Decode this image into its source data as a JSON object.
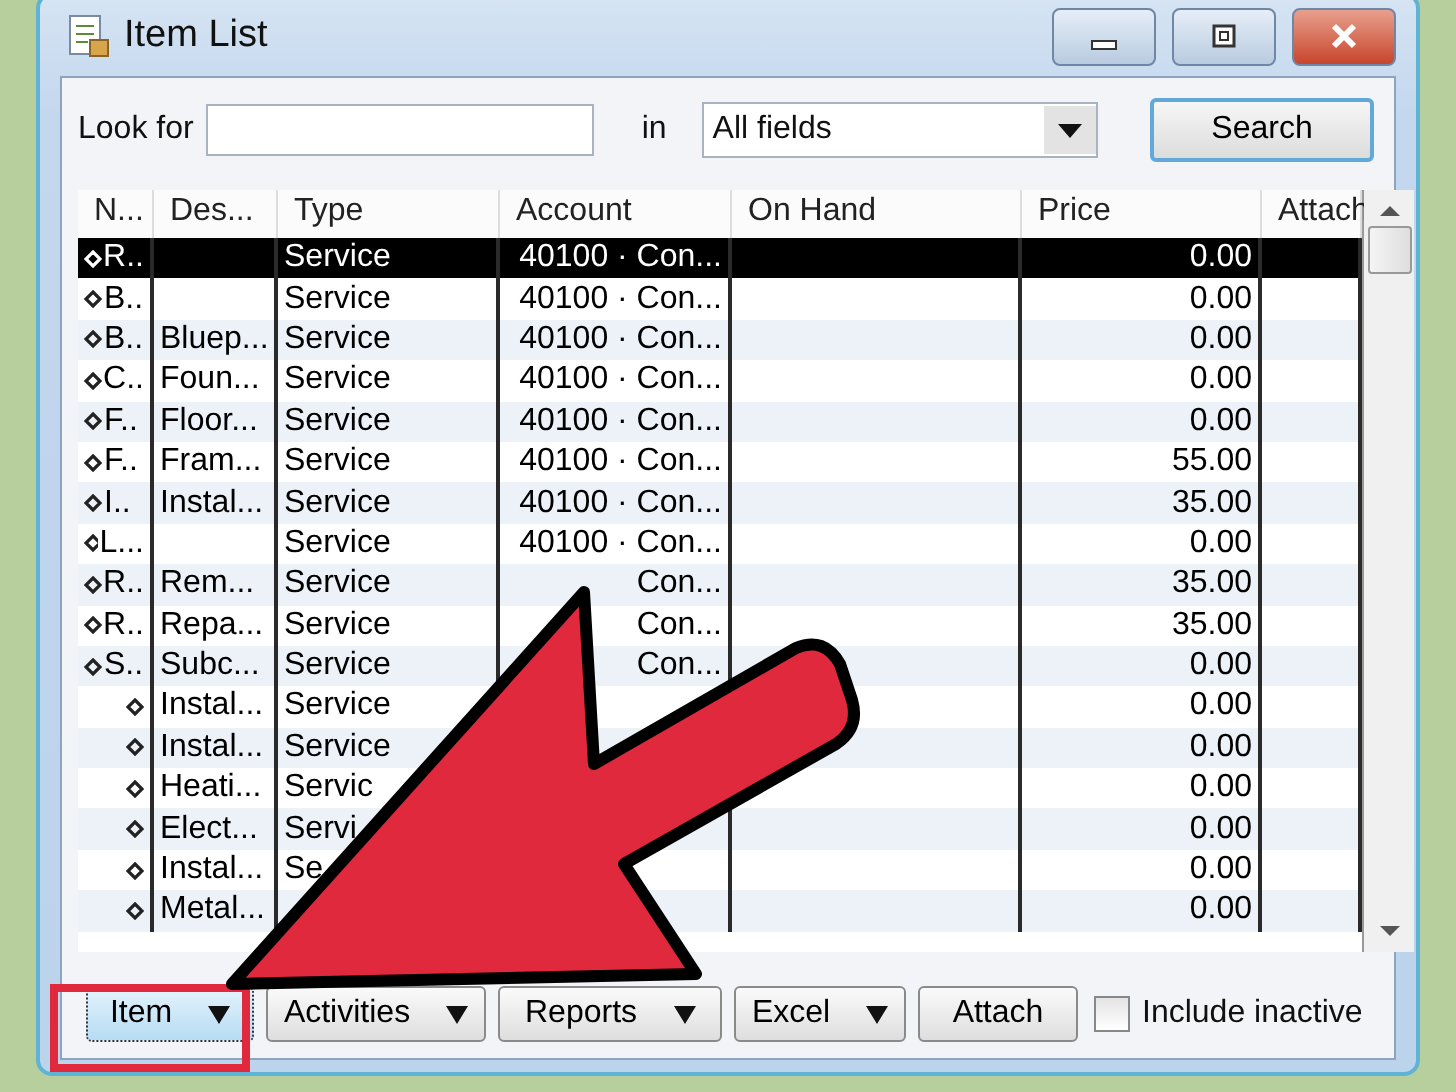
{
  "window": {
    "title": "Item List"
  },
  "search": {
    "label": "Look for",
    "in_label": "in",
    "field": "All fields",
    "button": "Search"
  },
  "columns": [
    "N...",
    "Des...",
    "Type",
    "Account",
    "On Hand",
    "Price",
    "Attach"
  ],
  "rows": [
    {
      "name": "R..",
      "type": "Service",
      "account": "40100 · Con...",
      "price": "0.00",
      "selected": true
    },
    {
      "name": "B..",
      "type": "Service",
      "account": "40100 · Con...",
      "price": "0.00",
      "selected": false
    },
    {
      "name": "B..",
      "description": "Bluep...",
      "type": "Service",
      "account": "40100 · Con...",
      "price": "0.00",
      "selected": false
    },
    {
      "name": "C..",
      "description": "Foun...",
      "type": "Service",
      "account": "40100 · Con...",
      "price": "0.00",
      "selected": false
    },
    {
      "name": "F..",
      "description": "Floor...",
      "type": "Service",
      "account": "40100 · Con...",
      "price": "0.00",
      "selected": false
    },
    {
      "name": "F..",
      "description": "Fram...",
      "type": "Service",
      "account": "40100 · Con...",
      "price": "55.00",
      "selected": false
    },
    {
      "name": "I..",
      "description": "Instal...",
      "type": "Service",
      "account": "40100 · Con...",
      "price": "35.00",
      "selected": false
    },
    {
      "name": "L...",
      "type": "Service",
      "account": "40100 · Con...",
      "price": "0.00",
      "selected": false
    },
    {
      "name": "R..",
      "description": "Rem...",
      "type": "Service",
      "account": "Con...",
      "price": "35.00",
      "selected": false
    },
    {
      "name": "R..",
      "description": "Repa...",
      "type": "Service",
      "account": "Con...",
      "price": "35.00",
      "selected": false
    },
    {
      "name": "S..",
      "description": "Subc...",
      "type": "Service",
      "account": "Con...",
      "price": "0.00",
      "selected": false,
      "children": [
        {
          "description": "Instal...",
          "type": "Service",
          "price": "0.00",
          "selected": false
        },
        {
          "description": "Instal...",
          "type": "Service",
          "price": "0.00",
          "selected": false
        },
        {
          "description": "Heati...",
          "type": "Servic",
          "price": "0.00",
          "selected": false
        },
        {
          "description": "Elect...",
          "type": "Servi",
          "price": "0.00",
          "selected": false
        },
        {
          "description": "Instal...",
          "type": "Se",
          "price": "0.00",
          "selected": false
        },
        {
          "description": "Metal...",
          "price": "0.00",
          "selected": false
        }
      ]
    }
  ],
  "buttons": [
    {
      "label": "Item",
      "menu": true
    },
    {
      "label": "Activities",
      "menu": true
    },
    {
      "label": "Reports",
      "menu": true
    },
    {
      "label": "Excel",
      "menu": true
    },
    {
      "label": "Attach",
      "menu": false
    }
  ],
  "include_inactive": {
    "label": "Include inactive",
    "checked": false
  },
  "annotations": [
    {
      "kind": "highlight"
    },
    {
      "kind": "arrow"
    }
  ]
}
